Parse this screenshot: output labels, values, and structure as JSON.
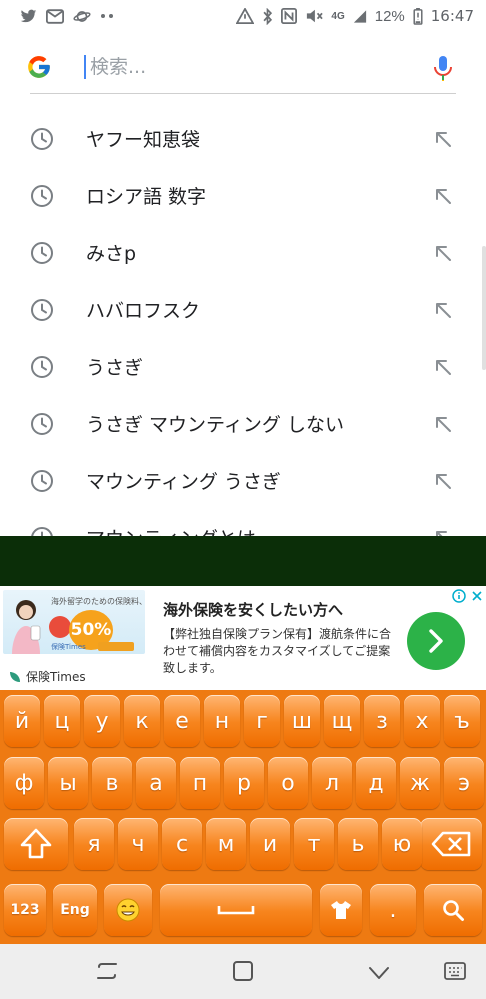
{
  "status_bar": {
    "network": "4G",
    "battery_percent": "12%",
    "time": "16:47",
    "icons": [
      "twitter-icon",
      "mail-icon",
      "saturn-icon",
      "more-dots-icon",
      "vpn-icon",
      "bluetooth-icon",
      "nfc-icon",
      "mute-icon",
      "signal-icon",
      "battery-icon"
    ]
  },
  "search": {
    "placeholder": "検索...",
    "value": ""
  },
  "suggestions": [
    {
      "label": "ヤフー知恵袋"
    },
    {
      "label": "ロシア語 数字"
    },
    {
      "label": "みさp"
    },
    {
      "label": "ハバロフスク"
    },
    {
      "label": "うさぎ"
    },
    {
      "label": "うさぎ マウンティング しない"
    },
    {
      "label": "マウンティング うさぎ"
    },
    {
      "label": "マウンティングとは"
    }
  ],
  "ad": {
    "title": "海外保険を安くしたい方へ",
    "body": "【弊社独自保険プラン保有】渡航条件に合わせて補償内容をカスタマイズしてご提案致します。",
    "brand": "保険Times",
    "image_brand": "保険Times",
    "image_percent": "50%",
    "image_caption": "海外留学のための保険料、安くならないかな…"
  },
  "keyboard": {
    "row1": [
      "й",
      "ц",
      "у",
      "к",
      "е",
      "н",
      "г",
      "ш",
      "щ",
      "з",
      "х",
      "ъ"
    ],
    "row2": [
      "ф",
      "ы",
      "в",
      "а",
      "п",
      "р",
      "о",
      "л",
      "д",
      "ж",
      "э"
    ],
    "row3": [
      "я",
      "ч",
      "с",
      "м",
      "и",
      "т",
      "ь",
      "ю"
    ],
    "row4": {
      "numbers": "123",
      "lang": "Eng",
      "period": "."
    }
  },
  "colors": {
    "keyboard_bg": "#ee7a12",
    "accent_blue": "#4285f4",
    "ad_button": "#2cb248"
  }
}
